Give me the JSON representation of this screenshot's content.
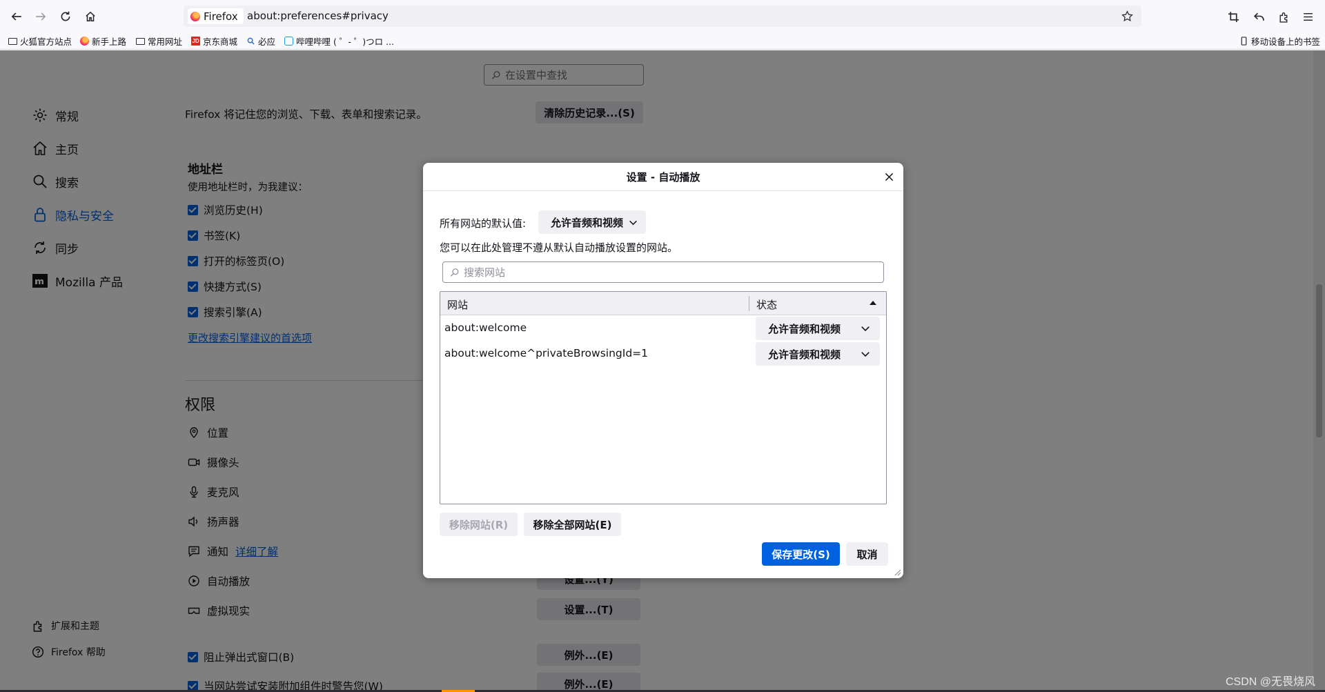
{
  "browser": {
    "identity_label": "Firefox",
    "url": "about:preferences#privacy",
    "bookmarks": [
      {
        "label": "火狐官方站点",
        "icon": "folder-icon"
      },
      {
        "label": "新手上路",
        "icon": "firefox-icon"
      },
      {
        "label": "常用网址",
        "icon": "folder-icon"
      },
      {
        "label": "京东商城",
        "icon": "jd-icon"
      },
      {
        "label": "必应",
        "icon": "bing-icon"
      },
      {
        "label": "哔哩哔哩 ( ゜- ゜)つロ ...",
        "icon": "bilibili-icon"
      }
    ],
    "mobile_bookmarks": "移动设备上的书签",
    "jd_glyph": "JD"
  },
  "prefs": {
    "search_placeholder": "在设置中查找",
    "categories": [
      "常规",
      "主页",
      "搜索",
      "隐私与安全",
      "同步",
      "Mozilla 产品"
    ],
    "footer": [
      "扩展和主题",
      "Firefox 帮助"
    ],
    "history_text": "Firefox 将记住您的浏览、下载、表单和搜索记录。",
    "clear_history_btn": "清除历史记录...(S)",
    "addressbar_title": "地址栏",
    "addressbar_desc": "使用地址栏时，为我建议：",
    "suggest_checks": [
      "浏览历史(H)",
      "书签(K)",
      "打开的标签页(O)",
      "快捷方式(S)",
      "搜索引擎(A)"
    ],
    "change_search_link": "更改搜索引擎建议的首选项",
    "permissions_title": "权限",
    "permissions": [
      "位置",
      "摄像头",
      "麦克风",
      "扬声器",
      "通知",
      "自动播放",
      "虚拟现实"
    ],
    "learn_more": "详细了解",
    "settings_btn": "设置...(T)",
    "settings_btn_autoplay": "设置...(Y)",
    "popup_check": "阻止弹出式窗口(B)",
    "addon_check": "当网站尝试安装附加组件时警告您(W)",
    "exceptions_btn": "例外...(E)"
  },
  "dialog": {
    "title": "设置 - 自动播放",
    "default_label": "所有网站的默认值:",
    "default_value": "允许音频和视频",
    "description": "您可以在此处管理不遵从默认自动播放设置的网站。",
    "search_placeholder": "搜索网站",
    "columns": [
      "网站",
      "状态"
    ],
    "rows": [
      {
        "site": "about:welcome",
        "status": "允许音频和视频"
      },
      {
        "site": "about:welcome^privateBrowsingId=1",
        "status": "允许音频和视频"
      }
    ],
    "remove_site_btn": "移除网站(R)",
    "remove_all_btn": "移除全部网站(E)",
    "save_btn": "保存更改(S)",
    "cancel_btn": "取消"
  },
  "watermark": "CSDN @无畏烧风",
  "colors": {
    "accent": "#0061e0",
    "overlay": "rgba(0,0,0,0.5)"
  }
}
